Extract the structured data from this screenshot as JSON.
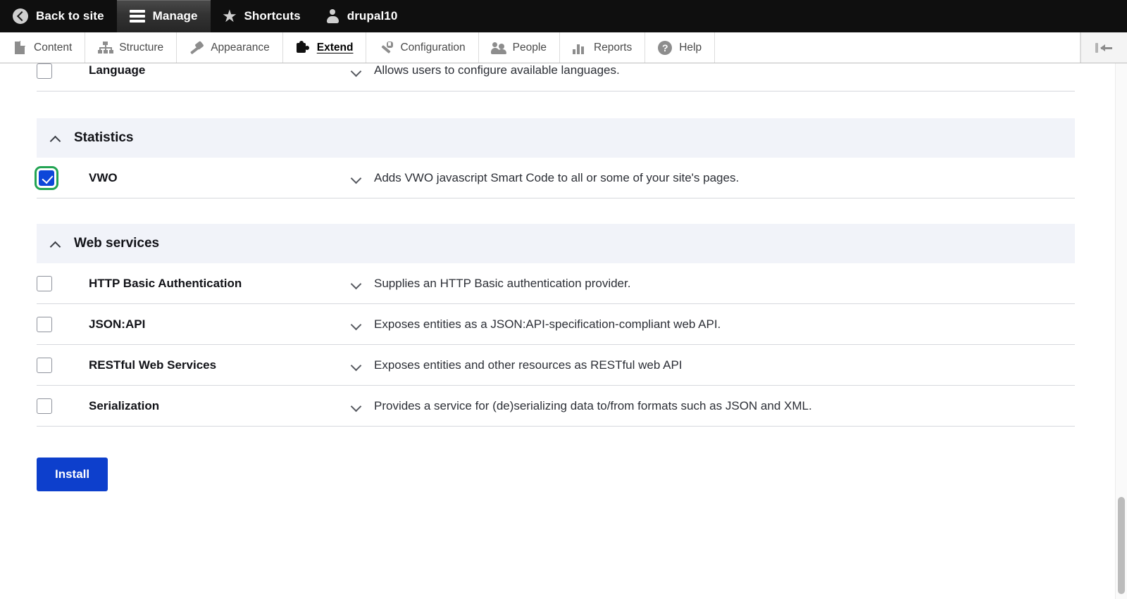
{
  "toolbar": {
    "items": [
      {
        "label": "Back to site",
        "icon": "back-arrow-icon",
        "active": false
      },
      {
        "label": "Manage",
        "icon": "hamburger-icon",
        "active": true
      },
      {
        "label": "Shortcuts",
        "icon": "star-icon",
        "active": false
      },
      {
        "label": "drupal10",
        "icon": "person-icon",
        "active": false
      }
    ]
  },
  "menu": {
    "items": [
      {
        "label": "Content",
        "icon": "document-icon",
        "active": false
      },
      {
        "label": "Structure",
        "icon": "structure-icon",
        "active": false
      },
      {
        "label": "Appearance",
        "icon": "paintbrush-icon",
        "active": false
      },
      {
        "label": "Extend",
        "icon": "puzzle-icon",
        "active": true
      },
      {
        "label": "Configuration",
        "icon": "wrench-icon",
        "active": false
      },
      {
        "label": "People",
        "icon": "people-icon",
        "active": false
      },
      {
        "label": "Reports",
        "icon": "bar-chart-icon",
        "active": false
      },
      {
        "label": "Help",
        "icon": "question-mark-icon",
        "active": false
      }
    ],
    "collapse_icon": "collapse-sidebar-icon"
  },
  "main": {
    "partial_top_row": {
      "name": "Language",
      "description": "Allows users to configure available languages.",
      "checked": false,
      "chevron": "chevron-down-icon"
    },
    "groups": [
      {
        "title": "Statistics",
        "chevron": "chevron-up-icon",
        "modules": [
          {
            "name": "VWO",
            "description": "Adds VWO javascript Smart Code to all or some of your site's pages.",
            "checked": true,
            "focused": true,
            "chevron": "chevron-down-icon"
          }
        ]
      },
      {
        "title": "Web services",
        "chevron": "chevron-up-icon",
        "modules": [
          {
            "name": "HTTP Basic Authentication",
            "description": "Supplies an HTTP Basic authentication provider.",
            "checked": false,
            "focused": false,
            "chevron": "chevron-down-icon"
          },
          {
            "name": "JSON:API",
            "description": "Exposes entities as a JSON:API-specification-compliant web API.",
            "checked": false,
            "focused": false,
            "chevron": "chevron-down-icon"
          },
          {
            "name": "RESTful Web Services",
            "description": "Exposes entities and other resources as RESTful web API",
            "checked": false,
            "focused": false,
            "chevron": "chevron-down-icon"
          },
          {
            "name": "Serialization",
            "description": "Provides a service for (de)serializing data to/from formats such as JSON and XML.",
            "checked": false,
            "focused": false,
            "chevron": "chevron-down-icon"
          }
        ]
      }
    ],
    "install_button": "Install"
  },
  "colors": {
    "toolbar_bg": "#0f0f0f",
    "accent_blue": "#0d3fcc",
    "checkbox_checked": "#0d47d9",
    "focus_green": "#23a453",
    "group_header_bg": "#f1f3f9"
  }
}
